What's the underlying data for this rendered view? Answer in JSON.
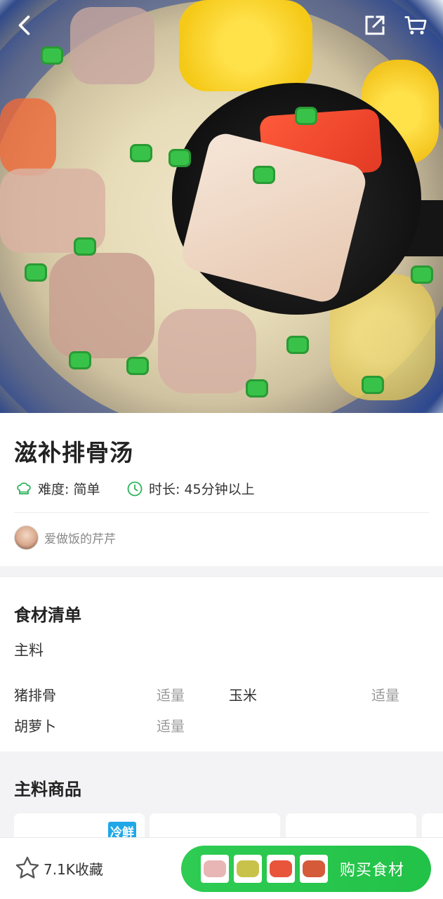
{
  "header": {
    "back_icon": "back-arrow-icon",
    "share_icon": "share-icon",
    "cart_icon": "cart-icon"
  },
  "recipe": {
    "title": "滋补排骨汤",
    "difficulty": "难度: 简单",
    "duration": "时长: 45分钟以上",
    "author": "爱做饭的芹芹"
  },
  "ingredients": {
    "section_title": "食材清单",
    "main_label": "主料",
    "items": [
      {
        "name": "猪排骨",
        "amount": "适量"
      },
      {
        "name": "玉米",
        "amount": "适量"
      },
      {
        "name": "胡萝卜",
        "amount": "适量"
      }
    ]
  },
  "products": {
    "section_title": "主料商品",
    "badge": "冷鲜"
  },
  "bottom_bar": {
    "favorites": "7.1K收藏",
    "buy_label": "购买食材"
  },
  "colors": {
    "accent_green": "#22c147",
    "icon_green": "#2db35a",
    "badge_blue": "#1fa7e8"
  }
}
